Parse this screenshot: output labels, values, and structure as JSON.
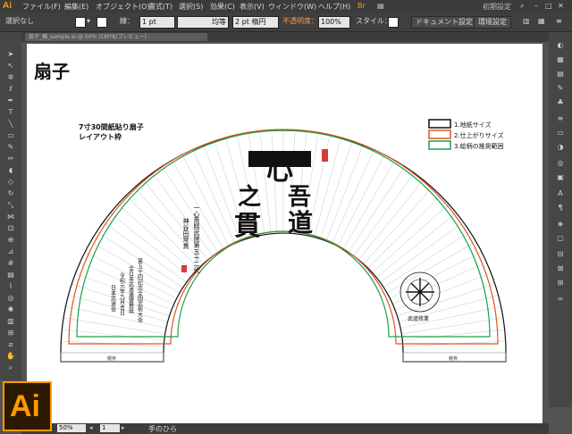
{
  "app": {
    "logo": "Ai",
    "workspace": "初期設定"
  },
  "menu": [
    "ファイル(F)",
    "編集(E)",
    "オブジェクト(O)",
    "書式(T)",
    "選択(S)",
    "効果(C)",
    "表示(V)",
    "ウィンドウ(W)",
    "ヘルプ(H)"
  ],
  "control": {
    "selection": "選択なし",
    "stroke_label": "線：",
    "stroke_weight": "1 pt",
    "profile": "均等",
    "brush": "2 pt 楕円",
    "opacity_label": "不透明度：",
    "opacity": "100%",
    "style_label": "スタイル：",
    "doc_settings": "ドキュメント設定",
    "preferences": "環境設定"
  },
  "document": {
    "tab": "扇子_横_sample.ai @ 50% (CMYK/プレビュー)"
  },
  "artwork": {
    "heading": "扇子",
    "subtitle_1": "7寸30間紙貼り扇子",
    "subtitle_2": "レイアウト枠",
    "legend": [
      {
        "label": "1.地紙サイズ",
        "color": "#111111"
      },
      {
        "label": "2.仕上がりサイズ",
        "color": "#e0561f"
      },
      {
        "label": "3.絵柄の推奨範囲",
        "color": "#1aa04a"
      }
    ],
    "calligraphy": [
      "心",
      "吾",
      "道",
      "之",
      "貫"
    ],
    "inscription_1": "一心斎精武館第五十二代",
    "inscription_2": "神谷田常貫",
    "left_text": [
      "第五十回記念全国武術大会",
      "全日本武道連盟推奨",
      "令和元年九月吉日",
      "日本武道会"
    ],
    "emblem_text": "武道修業",
    "left_label": "親骨",
    "right_label": "親骨"
  },
  "status": {
    "zoom": "50%",
    "page": "1",
    "tool": "手のひら"
  }
}
